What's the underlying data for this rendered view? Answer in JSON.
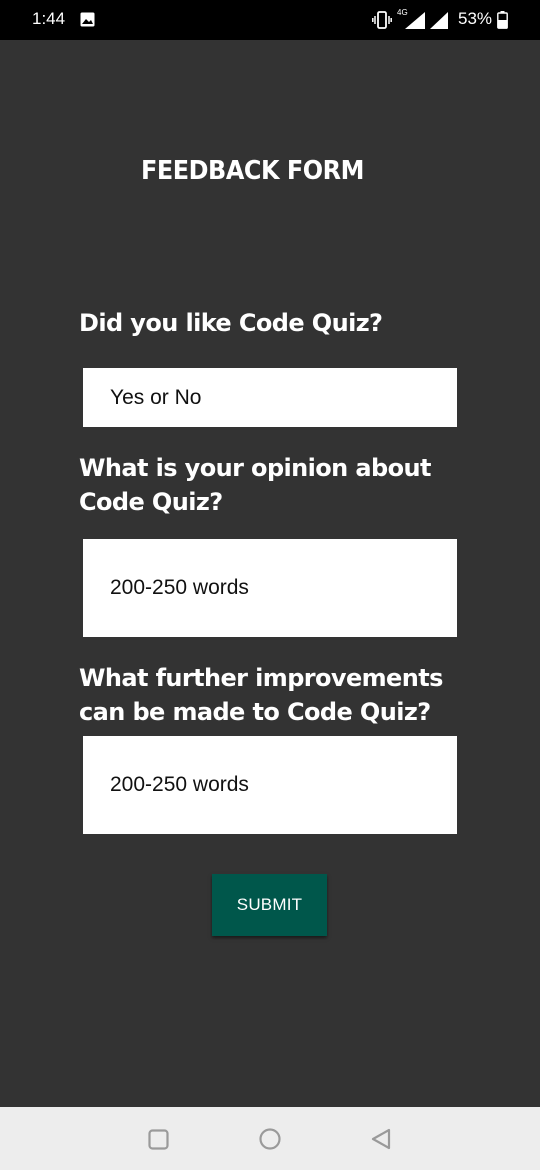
{
  "status_bar": {
    "time": "1:44",
    "network": "4G",
    "battery": "53%"
  },
  "form": {
    "title": "FEEDBACK FORM",
    "questions": [
      {
        "label": "Did you like Code Quiz?",
        "placeholder": "Yes or No"
      },
      {
        "label": "What is your opinion about Code Quiz?",
        "placeholder": "200-250 words"
      },
      {
        "label": "What further improvements can be made to Code Quiz?",
        "placeholder": "200-250 words"
      }
    ],
    "submit_label": "SUBMIT"
  },
  "colors": {
    "background": "#333333",
    "input": "#ffffff",
    "submit": "#00574b",
    "status_bar": "#000000",
    "nav_bar": "#ededed"
  },
  "icons": {
    "status": [
      "gallery-icon",
      "vibrate-icon",
      "signal-icon",
      "battery-icon"
    ],
    "nav": [
      "recent-apps-icon",
      "home-icon",
      "back-icon"
    ]
  }
}
